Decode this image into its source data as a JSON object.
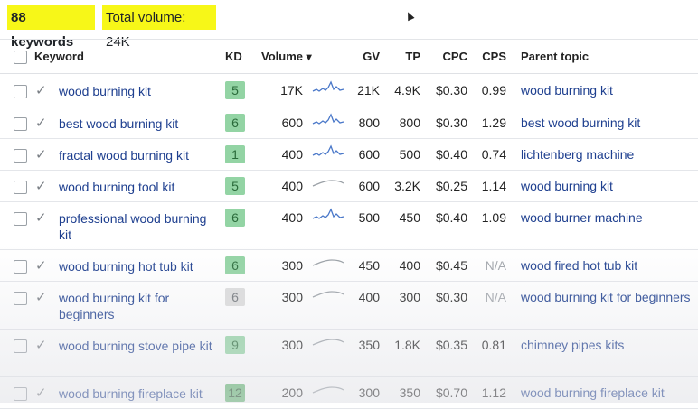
{
  "summary": {
    "keywords_count": "88 keywords",
    "total_volume": "Total volume: 24K"
  },
  "columns": {
    "keyword": "Keyword",
    "kd": "KD",
    "volume": "Volume",
    "gv": "GV",
    "tp": "TP",
    "cpc": "CPC",
    "cps": "CPS",
    "parent_topic": "Parent topic"
  },
  "sort_indicator": "▾",
  "colors": {
    "kd_green": "#93d4a4",
    "kd_green_text": "#2a6b3a",
    "kd_gray": "#dcdcdc",
    "kd_gray_text": "#6f7378",
    "kd_dark_green": "#5eb36d",
    "kd_dark_green_text": "#16461f",
    "link": "#1e3f8f",
    "highlight": "#f7f718",
    "spark_blue": "#4a78c9",
    "spark_gray": "#9aa0a6"
  },
  "rows": [
    {
      "keyword": "wood burning kit",
      "kd": "5",
      "kd_color": "green",
      "volume": "17K",
      "trend": "spiky",
      "gv": "21K",
      "tp": "4.9K",
      "cpc": "$0.30",
      "cps": "0.99",
      "parent": "wood burning kit"
    },
    {
      "keyword": "best wood burning kit",
      "kd": "6",
      "kd_color": "green",
      "volume": "600",
      "trend": "spiky",
      "gv": "800",
      "tp": "800",
      "cpc": "$0.30",
      "cps": "1.29",
      "parent": "best wood burning kit"
    },
    {
      "keyword": "fractal wood burning kit",
      "kd": "1",
      "kd_color": "green",
      "volume": "400",
      "trend": "spiky",
      "gv": "600",
      "tp": "500",
      "cpc": "$0.40",
      "cps": "0.74",
      "parent": "lichtenberg machine"
    },
    {
      "keyword": "wood burning tool kit",
      "kd": "5",
      "kd_color": "green",
      "volume": "400",
      "trend": "flat",
      "gv": "600",
      "tp": "3.2K",
      "cpc": "$0.25",
      "cps": "1.14",
      "parent": "wood burning kit"
    },
    {
      "keyword": "professional wood burning kit",
      "kd": "6",
      "kd_color": "green",
      "volume": "400",
      "trend": "spiky",
      "gv": "500",
      "tp": "450",
      "cpc": "$0.40",
      "cps": "1.09",
      "parent": "wood burner machine"
    },
    {
      "keyword": "wood burning hot tub kit",
      "kd": "6",
      "kd_color": "green",
      "volume": "300",
      "trend": "flat",
      "gv": "450",
      "tp": "400",
      "cpc": "$0.45",
      "cps": "N/A",
      "parent": "wood fired hot tub kit"
    },
    {
      "keyword": "wood burning kit for beginners",
      "kd": "6",
      "kd_color": "gray",
      "volume": "300",
      "trend": "flat",
      "gv": "400",
      "tp": "300",
      "cpc": "$0.30",
      "cps": "N/A",
      "parent": "wood burning kit for beginners"
    },
    {
      "keyword": "wood burning stove pipe kit",
      "kd": "9",
      "kd_color": "green",
      "volume": "300",
      "trend": "flat",
      "gv": "350",
      "tp": "1.8K",
      "cpc": "$0.35",
      "cps": "0.81",
      "parent": "chimney pipes kits"
    },
    {
      "keyword": "wood burning fireplace kit",
      "kd": "12",
      "kd_color": "dark_green",
      "volume": "200",
      "trend": "flat",
      "gv": "300",
      "tp": "350",
      "cpc": "$0.70",
      "cps": "1.12",
      "parent": "wood burning fireplace kit"
    }
  ]
}
